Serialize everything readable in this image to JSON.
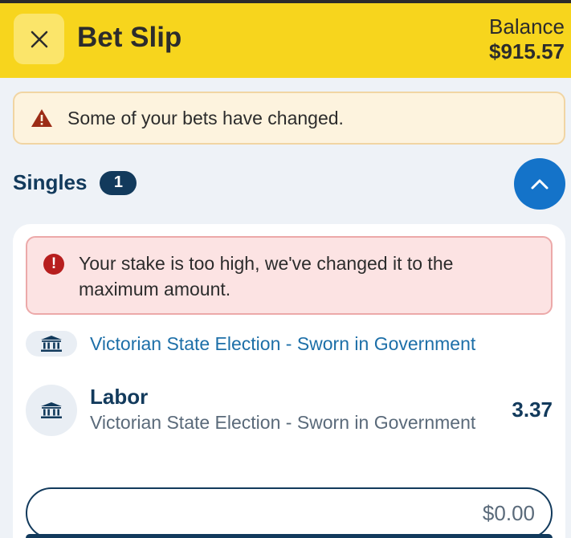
{
  "header": {
    "title": "Bet Slip",
    "balance_label": "Balance",
    "balance_amount": "$915.57",
    "close_icon": "close-icon",
    "accent": "#f7d51d"
  },
  "alert": {
    "message": "Some of your bets have changed.",
    "icon": "warning-icon"
  },
  "singles": {
    "label": "Singles",
    "count": "1",
    "toggle_icon": "chevron-up-icon"
  },
  "bet": {
    "error_message": "Your stake is too high, we've changed it to the maximum amount.",
    "error_icon": "error-icon",
    "event_title": "Victorian State Election - Sworn in Government",
    "event_icon": "government-building-icon",
    "selection_name": "Labor",
    "selection_market": "Victorian State Election - Sworn in Government",
    "odds": "3.37",
    "stake_value": "$0.00"
  }
}
